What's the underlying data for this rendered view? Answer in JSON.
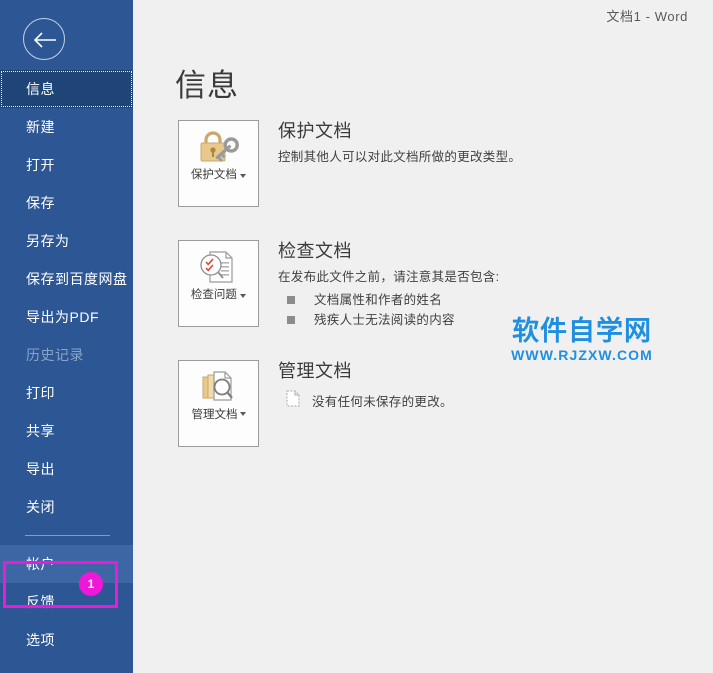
{
  "window": {
    "document_title": "文档1  -  Word"
  },
  "sidebar": {
    "back_icon": "back-arrow-icon",
    "items": [
      {
        "label": "信息",
        "state": "selected"
      },
      {
        "label": "新建",
        "state": "normal"
      },
      {
        "label": "打开",
        "state": "normal"
      },
      {
        "label": "保存",
        "state": "normal"
      },
      {
        "label": "另存为",
        "state": "normal"
      },
      {
        "label": "保存到百度网盘",
        "state": "normal"
      },
      {
        "label": "导出为PDF",
        "state": "normal"
      },
      {
        "label": "历史记录",
        "state": "disabled"
      },
      {
        "label": "打印",
        "state": "normal"
      },
      {
        "label": "共享",
        "state": "normal"
      },
      {
        "label": "导出",
        "state": "normal"
      },
      {
        "label": "关闭",
        "state": "normal"
      },
      {
        "label": "帐户",
        "state": "highlighted"
      },
      {
        "label": "反馈",
        "state": "normal"
      },
      {
        "label": "选项",
        "state": "normal"
      }
    ],
    "annotation": {
      "badge": "1",
      "color": "#f018d8",
      "target": "帐户"
    }
  },
  "main": {
    "page_title": "信息",
    "sections": [
      {
        "button_caption": "保护文档",
        "button_icon": "padlock-key-icon",
        "heading": "保护文档",
        "description": "控制其他人可以对此文档所做的更改类型。",
        "bullets": []
      },
      {
        "button_caption": "检查问题",
        "button_icon": "document-inspect-icon",
        "heading": "检查文档",
        "description": "在发布此文件之前，请注意其是否包含:",
        "bullets": [
          "文档属性和作者的姓名",
          "残疾人士无法阅读的内容"
        ]
      },
      {
        "button_caption": "管理文档",
        "button_icon": "manage-documents-icon",
        "heading": "管理文档",
        "description": "",
        "meta_icon": "document-page-icon",
        "meta_line": "没有任何未保存的更改。",
        "bullets": []
      }
    ]
  },
  "watermark": {
    "cn": "软件自学网",
    "en": "WWW.RJZXW.COM",
    "color": "#1f8fe0"
  },
  "colors": {
    "sidebar_bg": "#2d5694",
    "sidebar_selected": "#1f4578",
    "sidebar_highlight": "#3c66a4",
    "main_bg": "#f0f0f0",
    "accent_pink": "#f018d8"
  }
}
